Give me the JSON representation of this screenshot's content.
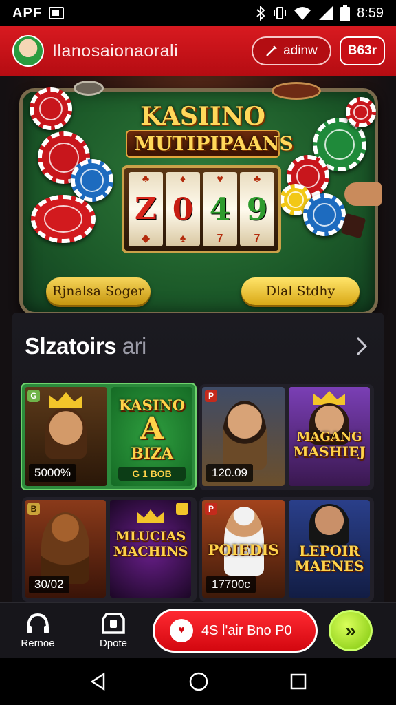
{
  "status_bar": {
    "carrier": "APF",
    "time": "8:59"
  },
  "header": {
    "title": "Ilanosaionaorali",
    "button_label": "adinw",
    "button2_label": "B63r"
  },
  "hero": {
    "title_line1": "KASIINO",
    "title_line2": "MUTIPIPAANS",
    "reels": [
      {
        "top": "♣",
        "digit": "Z",
        "bottom": "◆",
        "color": "#d6241a"
      },
      {
        "top": "♦",
        "digit": "0",
        "bottom": "♠",
        "color": "#c71d12"
      },
      {
        "top": "♥",
        "digit": "4",
        "bottom": "7",
        "color": "#2e9b2e"
      },
      {
        "top": "♣",
        "digit": "9",
        "bottom": "7",
        "color": "#2e9b2e"
      }
    ],
    "left_button": "Rjnalsa Soger",
    "right_button": "Dlal Stdhy"
  },
  "section": {
    "title": "Slzatoirs",
    "subtitle": "ari"
  },
  "games": [
    {
      "title_lines": [
        "KASINO",
        "A",
        "BIZA"
      ],
      "price": "5000%",
      "tag": "G 1 BOB"
    },
    {
      "title_lines": [],
      "price": "120.09"
    },
    {
      "title_lines": [
        "MAGANG",
        "MASHIEJ"
      ],
      "price": ""
    },
    {
      "title_lines": [],
      "price": "30/02"
    },
    {
      "title_lines": [
        "MLUCIAS",
        "MACHINS"
      ],
      "price": ""
    },
    {
      "title_lines": [
        "POIEDIS"
      ],
      "price": "17700c"
    },
    {
      "title_lines": [
        "LEPOIR",
        "MAENES"
      ],
      "price": ""
    }
  ],
  "bottom_bar": {
    "nav1": "Rernoe",
    "nav2": "Dpote",
    "deposit_label": "4S l'air Bno P0",
    "go_label": "»"
  },
  "colors": {
    "brand_red": "#d81a20",
    "felt_green": "#1c5a29",
    "gold": "#ffd34a",
    "go_green": "#7fc60d"
  }
}
